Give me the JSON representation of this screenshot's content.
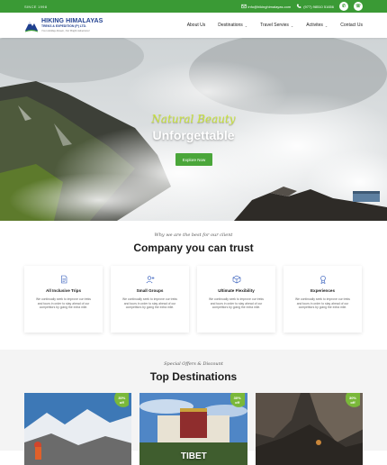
{
  "topbar": {
    "since": "SINCE 1998",
    "email": "info@hikinghimalayas.com",
    "phone": "(977) 98510 51656",
    "social": [
      "whatsapp-icon",
      "viber-icon"
    ]
  },
  "logo": {
    "title": "HIKING HIMALAYAS",
    "subtitle": "TREKS & EXPEDITION (P) LTD.",
    "tagline": "Your Holiday Dream, Our Bright Adventure!"
  },
  "nav": {
    "items": [
      {
        "label": "About Us",
        "dropdown": false
      },
      {
        "label": "Destinations",
        "dropdown": true
      },
      {
        "label": "Travel Servies",
        "dropdown": true
      },
      {
        "label": "Activites",
        "dropdown": true
      },
      {
        "label": "Contact Us",
        "dropdown": false
      }
    ]
  },
  "hero": {
    "script": "Natural Beauty",
    "title": "Unforgettable",
    "button": "Explore Now"
  },
  "trust": {
    "eyebrow": "Why we are the best for our client",
    "title": "Company you can trust",
    "cards": [
      {
        "icon": "document-icon",
        "title": "All Inclusive Trips",
        "desc": "We continually seek to improve our treks and tours in order to stay ahead of our competitors by going the extra mile."
      },
      {
        "icon": "add-user-icon",
        "title": "Small Groups",
        "desc": "We continually seek to improve our treks and tours in order to stay ahead of our competitors by going the extra mile."
      },
      {
        "icon": "box-icon",
        "title": "Ultimate Flexibility",
        "desc": "We continually seek to improve our treks and tours in order to stay ahead of our competitors by going the extra mile."
      },
      {
        "icon": "award-icon",
        "title": "Experiences",
        "desc": "We continually seek to improve our treks and tours in order to stay ahead of our competitors by going the extra mile."
      }
    ]
  },
  "destinations": {
    "eyebrow": "Special Offers & Discount",
    "title": "Top Destinations",
    "cards": [
      {
        "name": "",
        "badge_pct": "30%",
        "badge_off": "off"
      },
      {
        "name": "TIBET",
        "badge_pct": "30%",
        "badge_off": "off"
      },
      {
        "name": "",
        "badge_pct": "30%",
        "badge_off": "off"
      }
    ]
  },
  "colors": {
    "brand_green": "#3a9a35",
    "button_green": "#4aa63a",
    "logo_blue": "#1f3f8f",
    "accent_lime": "#c9e23a"
  }
}
